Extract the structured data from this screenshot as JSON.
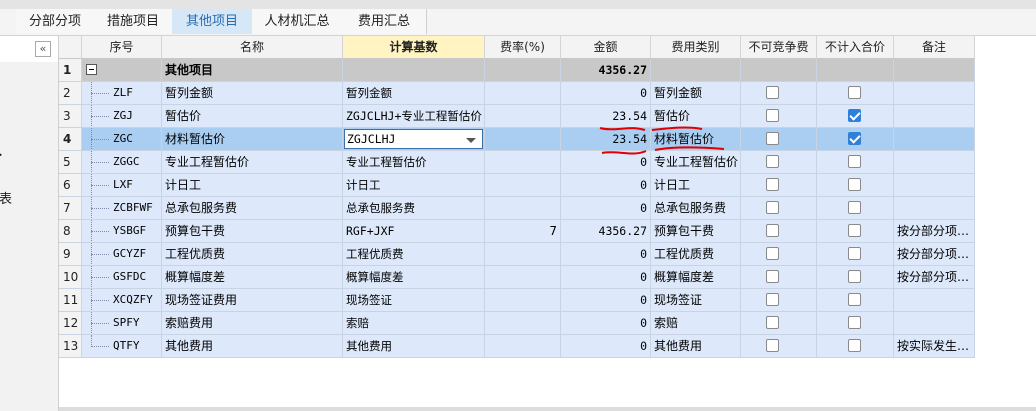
{
  "tabs": [
    {
      "label": "分部分项",
      "active": false
    },
    {
      "label": "措施项目",
      "active": false
    },
    {
      "label": "其他项目",
      "active": true
    },
    {
      "label": "人材机汇总",
      "active": false
    },
    {
      "label": "费用汇总",
      "active": false
    }
  ],
  "sidebar": {
    "collapse_label": "«",
    "chars": [
      "表"
    ]
  },
  "columns": [
    "序号",
    "名称",
    "计算基数",
    "费率(%)",
    "金额",
    "费用类别",
    "不可竞争费",
    "不计入合价",
    "备注"
  ],
  "rows": [
    {
      "no": "1",
      "code": "",
      "name": "其他项目",
      "base": "",
      "rate": "",
      "amount": "4356.27",
      "category": "",
      "noncompete": null,
      "exclude": null,
      "remark": ""
    },
    {
      "no": "2",
      "code": "ZLF",
      "name": "暂列金额",
      "base": "暂列金额",
      "rate": "",
      "amount": "0",
      "category": "暂列金额",
      "noncompete": false,
      "exclude": false,
      "remark": ""
    },
    {
      "no": "3",
      "code": "ZGJ",
      "name": "暂估价",
      "base": "ZGJCLHJ+专业工程暂估价",
      "rate": "",
      "amount": "23.54",
      "category": "暂估价",
      "noncompete": false,
      "exclude": true,
      "remark": ""
    },
    {
      "no": "4",
      "code": "ZGC",
      "name": "材料暂估价",
      "base": "ZGJCLHJ",
      "rate": "",
      "amount": "23.54",
      "category": "材料暂估价",
      "noncompete": false,
      "exclude": true,
      "remark": ""
    },
    {
      "no": "5",
      "code": "ZGGC",
      "name": "专业工程暂估价",
      "base": "专业工程暂估价",
      "rate": "",
      "amount": "0",
      "category": "专业工程暂估价",
      "noncompete": false,
      "exclude": false,
      "remark": ""
    },
    {
      "no": "6",
      "code": "LXF",
      "name": "计日工",
      "base": "计日工",
      "rate": "",
      "amount": "0",
      "category": "计日工",
      "noncompete": false,
      "exclude": false,
      "remark": ""
    },
    {
      "no": "7",
      "code": "ZCBFWF",
      "name": "总承包服务费",
      "base": "总承包服务费",
      "rate": "",
      "amount": "0",
      "category": "总承包服务费",
      "noncompete": false,
      "exclude": false,
      "remark": ""
    },
    {
      "no": "8",
      "code": "YSBGF",
      "name": "预算包干费",
      "base": "RGF+JXF",
      "rate": "7",
      "amount": "4356.27",
      "category": "预算包干费",
      "noncompete": false,
      "exclude": false,
      "remark": "按分部分项…"
    },
    {
      "no": "9",
      "code": "GCYZF",
      "name": "工程优质费",
      "base": "工程优质费",
      "rate": "",
      "amount": "0",
      "category": "工程优质费",
      "noncompete": false,
      "exclude": false,
      "remark": "按分部分项…"
    },
    {
      "no": "10",
      "code": "GSFDC",
      "name": "概算幅度差",
      "base": "概算幅度差",
      "rate": "",
      "amount": "0",
      "category": "概算幅度差",
      "noncompete": false,
      "exclude": false,
      "remark": "按分部分项…"
    },
    {
      "no": "11",
      "code": "XCQZFY",
      "name": "现场签证费用",
      "base": "现场签证",
      "rate": "",
      "amount": "0",
      "category": "现场签证",
      "noncompete": false,
      "exclude": false,
      "remark": ""
    },
    {
      "no": "12",
      "code": "SPFY",
      "name": "索赔费用",
      "base": "索赔",
      "rate": "",
      "amount": "0",
      "category": "索赔",
      "noncompete": false,
      "exclude": false,
      "remark": ""
    },
    {
      "no": "13",
      "code": "QTFY",
      "name": "其他费用",
      "base": "其他费用",
      "rate": "",
      "amount": "0",
      "category": "其他费用",
      "noncompete": false,
      "exclude": false,
      "remark": "按实际发生…"
    }
  ],
  "selected_row": 3,
  "selected_column": 2,
  "colors": {
    "row_bg": "#dde9fa",
    "selected_bg": "#a9cef2",
    "group_bg": "#c8c8c8",
    "annotation": "#e00000",
    "active_tab": "#2b6cb0"
  }
}
